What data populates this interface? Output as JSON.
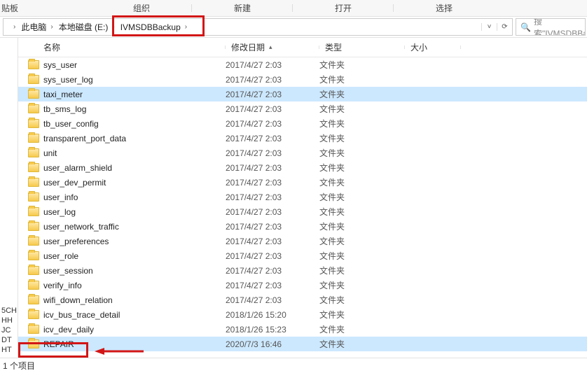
{
  "toolbar": {
    "clipboard": "贴板",
    "organize": "组织",
    "new": "新建",
    "open": "打开",
    "select": "选择"
  },
  "breadcrumb": {
    "segments": [
      "此电脑",
      "本地磁盘 (E:)",
      "IVMSDBBackup"
    ]
  },
  "search": {
    "placeholder": "搜索\"IVMSDBBa"
  },
  "columns": {
    "name": "名称",
    "date": "修改日期",
    "type": "类型",
    "size": "大小"
  },
  "rows": [
    {
      "name": "sys_user",
      "date": "2017/4/27 2:03",
      "type": "文件夹",
      "selected": false
    },
    {
      "name": "sys_user_log",
      "date": "2017/4/27 2:03",
      "type": "文件夹",
      "selected": false
    },
    {
      "name": "taxi_meter",
      "date": "2017/4/27 2:03",
      "type": "文件夹",
      "selected": true
    },
    {
      "name": "tb_sms_log",
      "date": "2017/4/27 2:03",
      "type": "文件夹",
      "selected": false
    },
    {
      "name": "tb_user_config",
      "date": "2017/4/27 2:03",
      "type": "文件夹",
      "selected": false
    },
    {
      "name": "transparent_port_data",
      "date": "2017/4/27 2:03",
      "type": "文件夹",
      "selected": false
    },
    {
      "name": "unit",
      "date": "2017/4/27 2:03",
      "type": "文件夹",
      "selected": false
    },
    {
      "name": "user_alarm_shield",
      "date": "2017/4/27 2:03",
      "type": "文件夹",
      "selected": false
    },
    {
      "name": "user_dev_permit",
      "date": "2017/4/27 2:03",
      "type": "文件夹",
      "selected": false
    },
    {
      "name": "user_info",
      "date": "2017/4/27 2:03",
      "type": "文件夹",
      "selected": false
    },
    {
      "name": "user_log",
      "date": "2017/4/27 2:03",
      "type": "文件夹",
      "selected": false
    },
    {
      "name": "user_network_traffic",
      "date": "2017/4/27 2:03",
      "type": "文件夹",
      "selected": false
    },
    {
      "name": "user_preferences",
      "date": "2017/4/27 2:03",
      "type": "文件夹",
      "selected": false
    },
    {
      "name": "user_role",
      "date": "2017/4/27 2:03",
      "type": "文件夹",
      "selected": false
    },
    {
      "name": "user_session",
      "date": "2017/4/27 2:03",
      "type": "文件夹",
      "selected": false
    },
    {
      "name": "verify_info",
      "date": "2017/4/27 2:03",
      "type": "文件夹",
      "selected": false
    },
    {
      "name": "wifi_down_relation",
      "date": "2017/4/27 2:03",
      "type": "文件夹",
      "selected": false
    },
    {
      "name": "icv_bus_trace_detail",
      "date": "2018/1/26 15:20",
      "type": "文件夹",
      "selected": false
    },
    {
      "name": "icv_dev_daily",
      "date": "2018/1/26 15:23",
      "type": "文件夹",
      "selected": false
    },
    {
      "name": "REPAIR",
      "date": "2020/7/3 16:46",
      "type": "文件夹",
      "selected": true
    }
  ],
  "nav_labels": [
    "5CH",
    "HH",
    "JC",
    "DT",
    "HT"
  ],
  "status": "1 个项目"
}
